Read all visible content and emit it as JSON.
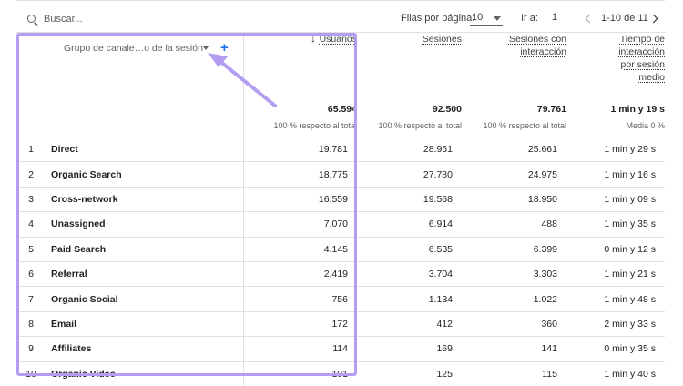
{
  "toolbar": {
    "search_placeholder": "Buscar...",
    "rows_label": "Filas por página:",
    "rows_value": "10",
    "goto_label": "Ir a:",
    "goto_value": "1",
    "range": "1-10 de 11"
  },
  "table": {
    "dimension_header": "Grupo de canale…o de la sesión",
    "columns": [
      {
        "title_lines": [
          "Usuarios"
        ],
        "sorted": true,
        "total": "65.594",
        "total_sub": "100 % respecto al total"
      },
      {
        "title_lines": [
          "Sesiones"
        ],
        "sorted": false,
        "total": "92.500",
        "total_sub": "100 % respecto al total"
      },
      {
        "title_lines": [
          "Sesiones con",
          "interacción"
        ],
        "sorted": false,
        "total": "79.761",
        "total_sub": "100 % respecto al total"
      },
      {
        "title_lines": [
          "Tiempo de",
          "interacción",
          "por sesión",
          "medio"
        ],
        "sorted": false,
        "total": "1 min y 19 s",
        "total_sub": "Media 0 %"
      }
    ],
    "rows": [
      {
        "idx": "1",
        "channel": "Direct",
        "users": "19.781",
        "sessions": "28.951",
        "engaged": "25.661",
        "time": "1 min y 29 s"
      },
      {
        "idx": "2",
        "channel": "Organic Search",
        "users": "18.775",
        "sessions": "27.780",
        "engaged": "24.975",
        "time": "1 min y 16 s"
      },
      {
        "idx": "3",
        "channel": "Cross-network",
        "users": "16.559",
        "sessions": "19.568",
        "engaged": "18.950",
        "time": "1 min y 09 s"
      },
      {
        "idx": "4",
        "channel": "Unassigned",
        "users": "7.070",
        "sessions": "6.914",
        "engaged": "488",
        "time": "1 min y 35 s"
      },
      {
        "idx": "5",
        "channel": "Paid Search",
        "users": "4.145",
        "sessions": "6.535",
        "engaged": "6.399",
        "time": "0 min y 12 s"
      },
      {
        "idx": "6",
        "channel": "Referral",
        "users": "2.419",
        "sessions": "3.704",
        "engaged": "3.303",
        "time": "1 min y 21 s"
      },
      {
        "idx": "7",
        "channel": "Organic Social",
        "users": "756",
        "sessions": "1.134",
        "engaged": "1.022",
        "time": "1 min y 48 s"
      },
      {
        "idx": "8",
        "channel": "Email",
        "users": "172",
        "sessions": "412",
        "engaged": "360",
        "time": "2 min y 33 s"
      },
      {
        "idx": "9",
        "channel": "Affiliates",
        "users": "114",
        "sessions": "169",
        "engaged": "141",
        "time": "0 min y 35 s"
      },
      {
        "idx": "10",
        "channel": "Organic Video",
        "users": "101",
        "sessions": "125",
        "engaged": "115",
        "time": "1 min y 40 s"
      }
    ]
  },
  "icons": {
    "search": "search-icon",
    "sort": "arrow-down-icon",
    "add": "add-icon",
    "prev": "chevron-left-icon",
    "next": "chevron-right-icon"
  },
  "colors": {
    "highlight": "#b39df0",
    "accent": "#1a73e8"
  }
}
